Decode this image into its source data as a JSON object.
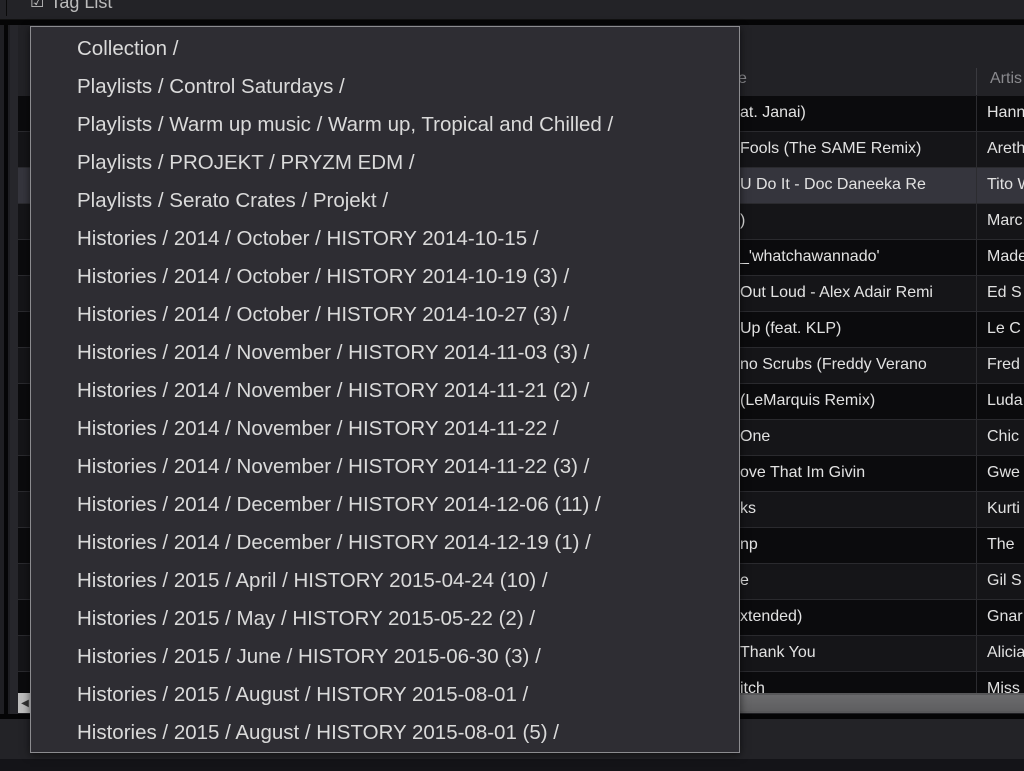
{
  "topbar": {
    "tab_label": "Tag List",
    "tab_icon": "tag-list-check-icon"
  },
  "table": {
    "columns": {
      "title": "Title",
      "title_visible": "e",
      "artist": "Artis"
    },
    "rows": [
      {
        "title": "at. Janai)",
        "artist": "Hann",
        "style": "odd"
      },
      {
        "title": "Fools (The SAME Remix)",
        "artist": "Areth",
        "style": "even"
      },
      {
        "title": "U Do It - Doc Daneeka Re",
        "artist": "Tito W",
        "style": "selected"
      },
      {
        "title": ")",
        "artist": "Marc",
        "style": "even"
      },
      {
        "title": "_'whatchawannado'",
        "artist": "Made",
        "style": "odd"
      },
      {
        "title": "Out Loud - Alex Adair Remi",
        "artist": "Ed S",
        "style": "even"
      },
      {
        "title": "Up (feat. KLP)",
        "artist": "Le C",
        "style": "odd"
      },
      {
        "title": "no Scrubs (Freddy Verano",
        "artist": "Fred",
        "style": "even"
      },
      {
        "title": " (LeMarquis Remix)",
        "artist": "Luda",
        "style": "odd"
      },
      {
        "title": " One",
        "artist": "Chic",
        "style": "even"
      },
      {
        "title": "ove That Im Givin",
        "artist": "Gwe",
        "style": "odd"
      },
      {
        "title": "ks",
        "artist": "Kurti",
        "style": "even"
      },
      {
        "title": "np",
        "artist": "The",
        "style": "odd"
      },
      {
        "title": "e",
        "artist": "Gil S",
        "style": "even"
      },
      {
        "title": "xtended)",
        "artist": "Gnar",
        "style": "odd"
      },
      {
        "title": " Thank You",
        "artist": "Alicia",
        "style": "even"
      },
      {
        "title": "itch",
        "artist": "Miss",
        "style": "odd"
      }
    ],
    "scroll_left_icon": "scroll-left-arrow-icon",
    "scroll_left_glyph": "◀"
  },
  "menu": {
    "items": [
      "Collection /",
      "Playlists / Control Saturdays /",
      "Playlists / Warm up music / Warm up, Tropical and Chilled /",
      "Playlists / PROJEKT / PRYZM EDM /",
      "Playlists / Serato Crates / Projekt /",
      "Histories / 2014 / October / HISTORY 2014-10-15 /",
      "Histories / 2014 / October / HISTORY 2014-10-19 (3) /",
      "Histories / 2014 / October / HISTORY 2014-10-27 (3) /",
      "Histories / 2014 / November / HISTORY 2014-11-03 (3) /",
      "Histories / 2014 / November / HISTORY 2014-11-21 (2) /",
      "Histories / 2014 / November / HISTORY 2014-11-22 /",
      "Histories / 2014 / November / HISTORY 2014-11-22 (3) /",
      "Histories / 2014 / December / HISTORY 2014-12-06 (11) /",
      "Histories / 2014 / December / HISTORY 2014-12-19 (1) /",
      "Histories / 2015 / April / HISTORY 2015-04-24 (10) /",
      "Histories / 2015 / May / HISTORY 2015-05-22 (2) /",
      "Histories / 2015 / June / HISTORY 2015-06-30 (3) /",
      "Histories / 2015 / August / HISTORY 2015-08-01 /",
      "Histories / 2015 / August / HISTORY 2015-08-01 (5) /"
    ]
  }
}
